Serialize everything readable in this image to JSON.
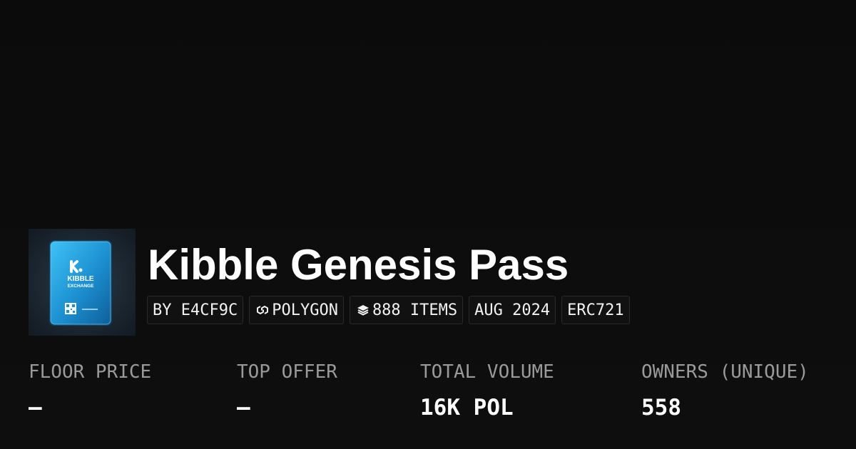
{
  "collection": {
    "title": "Kibble Genesis Pass",
    "thumbnail": {
      "brand_text": "KIBBLE",
      "brand_subtext": "EXCHANGE",
      "logo_mark": "K."
    }
  },
  "tags": [
    {
      "label": "BY E4CF9C",
      "icon": null
    },
    {
      "label": "POLYGON",
      "icon": "polygon-chain-icon"
    },
    {
      "label": "888 ITEMS",
      "icon": "layers-icon"
    },
    {
      "label": "AUG 2024",
      "icon": null
    },
    {
      "label": "ERC721",
      "icon": null
    }
  ],
  "stats": [
    {
      "label": "FLOOR PRICE",
      "value": "—"
    },
    {
      "label": "TOP OFFER",
      "value": "—"
    },
    {
      "label": "TOTAL VOLUME",
      "value": "16K POL"
    },
    {
      "label": "OWNERS (UNIQUE)",
      "value": "558"
    }
  ],
  "colors": {
    "background": "#0b0b0b",
    "tag_background": "#111111",
    "label_gray": "#9a9a9a",
    "card_accent": "#1fa8e6"
  }
}
